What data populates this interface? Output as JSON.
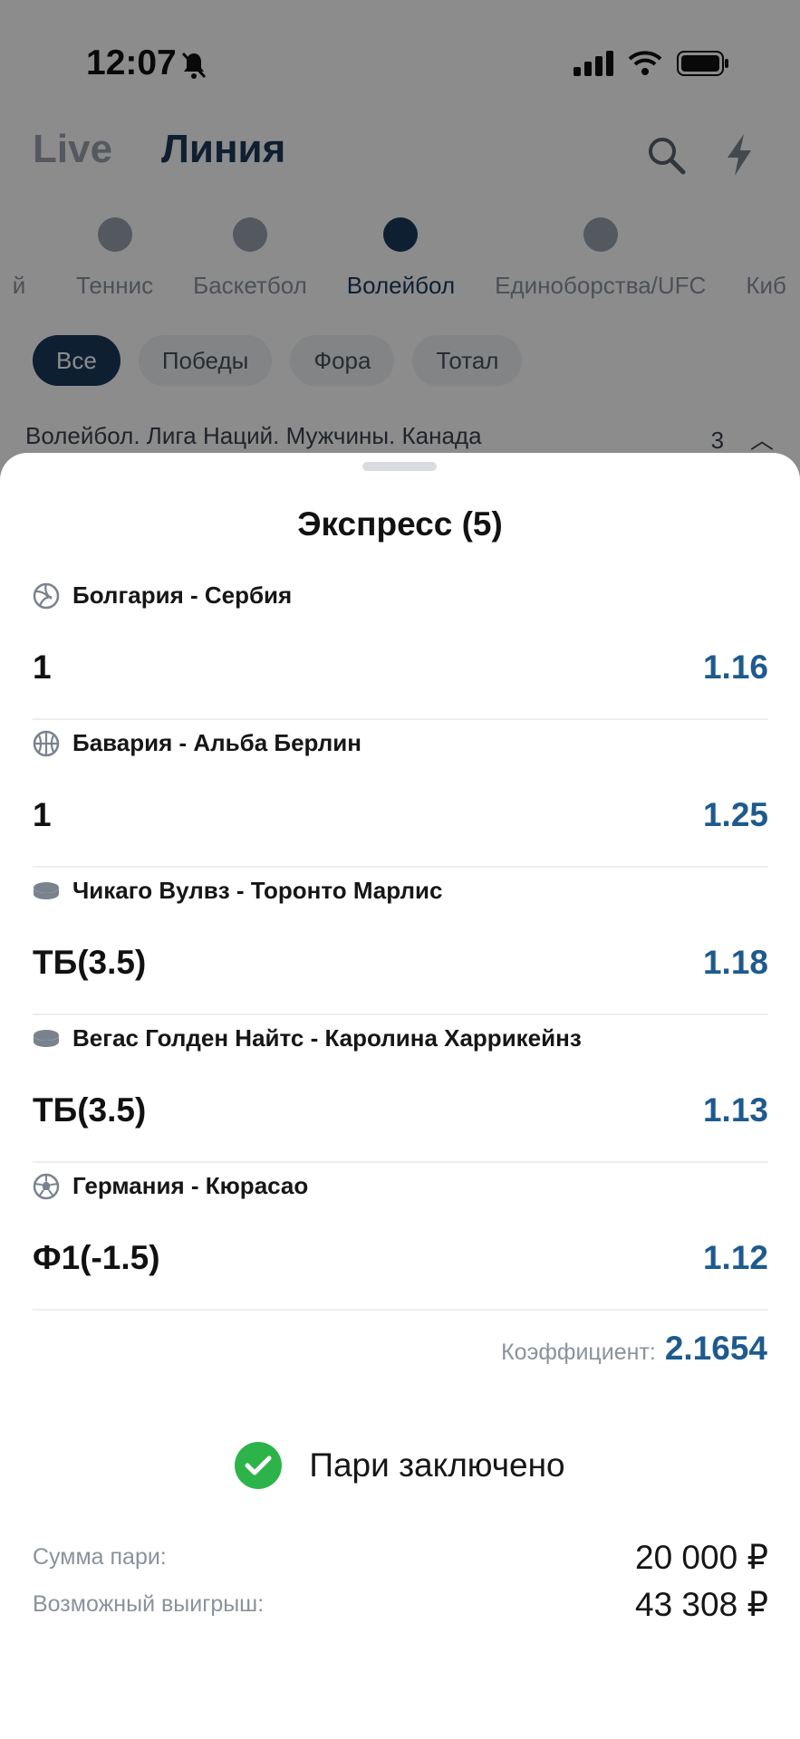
{
  "status_bar": {
    "time": "12:07"
  },
  "header": {
    "tabs": [
      "Live",
      "Линия"
    ]
  },
  "sports": [
    "й",
    "Теннис",
    "Баскетбол",
    "Волейбол",
    "Единоборства/UFC",
    "Киб"
  ],
  "filters": [
    "Все",
    "Победы",
    "Фора",
    "Тотал"
  ],
  "league": {
    "name": "Волейбол. Лига Наций. Мужчины. Канада",
    "count": "3"
  },
  "sheet": {
    "title": "Экспресс (5)",
    "bets": [
      {
        "sport_icon": "volleyball-icon",
        "event": "Болгария - Сербия",
        "pick": "1",
        "odd": "1.16"
      },
      {
        "sport_icon": "basketball-icon",
        "event": "Бавария - Альба Берлин",
        "pick": "1",
        "odd": "1.25"
      },
      {
        "sport_icon": "hockey-puck-icon",
        "event": "Чикаго Вулвз - Торонто Марлис",
        "pick": "ТБ(3.5)",
        "odd": "1.18"
      },
      {
        "sport_icon": "hockey-puck-icon",
        "event": "Вегас Голден Найтс - Каролина Харрикейнз",
        "pick": "ТБ(3.5)",
        "odd": "1.13"
      },
      {
        "sport_icon": "soccer-ball-icon",
        "event": "Германия - Кюрасао",
        "pick": "Ф1(-1.5)",
        "odd": "1.12"
      }
    ],
    "coefficient_label": "Коэффициент:",
    "coefficient_value": "2.1654",
    "status_text": "Пари заключено",
    "stake_label": "Сумма пари:",
    "stake_value": "20 000 ₽",
    "win_label": "Возможный выигрыш:",
    "win_value": "43 308 ₽"
  },
  "colors": {
    "accent": "#1e5a8e",
    "dark": "#1b3a5a",
    "success": "#2cb44a"
  }
}
